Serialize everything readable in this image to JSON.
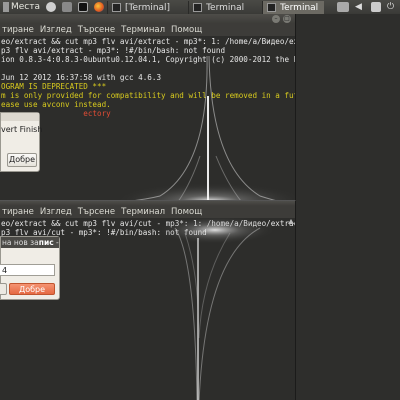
{
  "panel": {
    "places_label": "Места",
    "tasks": [
      {
        "label": "[Terminal]",
        "active": false
      },
      {
        "label": "Terminal",
        "active": false
      },
      {
        "label": "Terminal",
        "active": true
      }
    ]
  },
  "term1": {
    "menu": [
      "тиране",
      "Изглед",
      "Търсене",
      "Терминал",
      "Помощ"
    ],
    "lines": [
      {
        "t": "eo/extract && cut mp3 flv avi/extract - mp3*: 1: /home/a/Видео/extract",
        "c": "w"
      },
      {
        "t": "p3 flv avi/extract - mp3*: !#/bin/bash: not found",
        "c": "w"
      },
      {
        "t": "ion 0.8.3-4:0.8.3-0ubuntu0.12.04.1, Copyright (c) 2000-2012 the Libav",
        "c": "w"
      },
      {
        "t": "",
        "c": "w"
      },
      {
        "t": "Jun 12 2012 16:37:58 with gcc 4.6.3",
        "c": "w"
      },
      {
        "t": "OGRAM IS DEPRECATED ***",
        "c": "y"
      },
      {
        "t": "m is only provided for compatibility and will be removed in a future",
        "c": "y"
      },
      {
        "t": "ease use avconv instead.",
        "c": "y"
      },
      {
        "t": "                  ectory",
        "c": "r"
      }
    ]
  },
  "term2": {
    "menu": [
      "тиране",
      "Изглед",
      "Търсене",
      "Терминал",
      "Помощ"
    ],
    "lines": [
      {
        "t": "eo/extract && cut mp3 flv avi/cut - mp3*: 1: /home/a/Видео/extract &&",
        "c": "w"
      },
      {
        "t": "p3 flv avi/cut - mp3*: !#/bin/bash: not found",
        "c": "w"
      }
    ]
  },
  "dialog1": {
    "text": "vert  Finish",
    "ok_label": "Добре"
  },
  "dialog2": {
    "title_prefix": "на нов за",
    "title_bold": "пис",
    "title_suffix": " -",
    "field_value": "4",
    "ok_label": "Добре"
  }
}
